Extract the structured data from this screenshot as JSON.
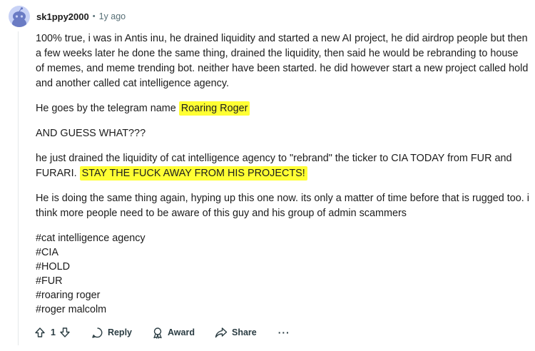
{
  "comment": {
    "username": "sk1ppy2000",
    "separator": "•",
    "time": "1y ago",
    "paragraphs": {
      "p1": "100% true, i was in Antis inu, he drained liquidity and started a new AI project, he did airdrop people but then a few weeks later he done the same thing, drained the liquidity, then said he would be rebranding to house of memes, and meme trending bot. neither have been started. he did however start a new project called hold and another called cat intelligence agency.",
      "p2_prefix": "He goes by the telegram name ",
      "p2_highlight": "Roaring Roger",
      "p3": "AND GUESS WHAT???",
      "p4_prefix": "he just drained the liquidity of cat intelligence agency to \"rebrand\" the ticker to CIA TODAY from FUR and FURARI. ",
      "p4_highlight": "STAY THE FUCK AWAY FROM HIS PROJECTS!",
      "p5": "He is doing the same thing again, hyping up this one now. its only a matter of time before that is rugged too. i think more people need to be aware of this guy and his group of admin scammers"
    },
    "tags": [
      "#cat intelligence agency",
      "#CIA",
      "#HOLD",
      "#FUR",
      "#roaring roger",
      "#roger malcolm"
    ]
  },
  "actions": {
    "vote_count": "1",
    "reply_label": "Reply",
    "award_label": "Award",
    "share_label": "Share",
    "more_label": "···"
  },
  "icons": {
    "upvote": "upvote-arrow-icon",
    "downvote": "downvote-arrow-icon",
    "reply": "speech-bubble-icon",
    "award": "award-ribbon-icon",
    "share": "share-arrow-icon",
    "avatar": "snoo-avatar-icon"
  },
  "colors": {
    "highlight": "#ffff33",
    "meta_text": "#576f76",
    "avatar_bg": "#c8d2f6"
  }
}
